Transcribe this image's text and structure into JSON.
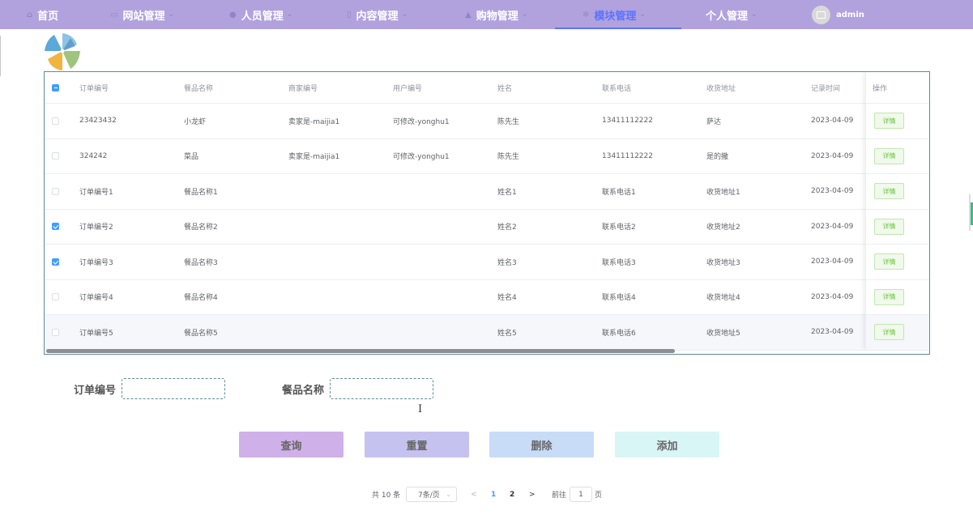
{
  "nav": {
    "items": [
      {
        "label": "首页",
        "icon": "home-icon",
        "glyph": "⌂",
        "caret": ""
      },
      {
        "label": "网站管理",
        "icon": "monitor-icon",
        "glyph": "▭",
        "caret": "⌄"
      },
      {
        "label": "人员管理",
        "icon": "user-icon",
        "glyph": "●",
        "caret": "⌄"
      },
      {
        "label": "内容管理",
        "icon": "document-icon",
        "glyph": "▯",
        "caret": "⌄"
      },
      {
        "label": "购物管理",
        "icon": "bag-icon",
        "glyph": "▲",
        "caret": "⌄"
      },
      {
        "label": "模块管理",
        "icon": "gear-icon",
        "glyph": "✲",
        "caret": "⌄"
      },
      {
        "label": "个人管理",
        "icon": "",
        "glyph": "",
        "caret": "⌄"
      }
    ],
    "active_index": 5,
    "active_color": "#5b73ff",
    "bar_color": "#b1a2de",
    "username": "admin"
  },
  "table": {
    "headers": [
      "订单编号",
      "餐品名称",
      "商家编号",
      "用户编号",
      "姓名",
      "联系电话",
      "收货地址",
      "记录时间",
      "操作"
    ],
    "rows": [
      {
        "checked": false,
        "cells": [
          "23423432",
          "小龙虾",
          "卖家是-maijia1",
          "可修改-yonghu1",
          "陈先生",
          "13411112222",
          "萨达",
          "2023-04-09"
        ],
        "action": "详情"
      },
      {
        "checked": false,
        "cells": [
          "324242",
          "菜品",
          "卖家是-maijia1",
          "可修改-yonghu1",
          "陈先生",
          "13411112222",
          "是的撒",
          "2023-04-09"
        ],
        "action": "详情"
      },
      {
        "checked": false,
        "cells": [
          "订单编号1",
          "餐品名称1",
          "",
          "",
          "姓名1",
          "联系电话1",
          "收货地址1",
          "2023-04-09"
        ],
        "action": "详情"
      },
      {
        "checked": true,
        "cells": [
          "订单编号2",
          "餐品名称2",
          "",
          "",
          "姓名2",
          "联系电话2",
          "收货地址2",
          "2023-04-09"
        ],
        "action": "详情"
      },
      {
        "checked": true,
        "cells": [
          "订单编号3",
          "餐品名称3",
          "",
          "",
          "姓名3",
          "联系电话3",
          "收货地址3",
          "2023-04-09"
        ],
        "action": "详情"
      },
      {
        "checked": false,
        "cells": [
          "订单编号4",
          "餐品名称4",
          "",
          "",
          "姓名4",
          "联系电话4",
          "收货地址4",
          "2023-04-09"
        ],
        "action": "详情"
      },
      {
        "checked": false,
        "cells": [
          "订单编号5",
          "餐品名称5",
          "",
          "",
          "姓名5",
          "联系电话6",
          "收货地址5",
          "2023-04-09"
        ],
        "action": "详情"
      }
    ],
    "header_checkbox": "indeterminate"
  },
  "search": {
    "order_no_label": "订单编号",
    "order_no_value": "",
    "dish_name_label": "餐品名称",
    "dish_name_value": ""
  },
  "actions": [
    {
      "label": "查询",
      "color": "#cfb0e8"
    },
    {
      "label": "重置",
      "color": "#c6c2ef"
    },
    {
      "label": "删除",
      "color": "#c8dcf8"
    },
    {
      "label": "添加",
      "color": "#d9f6f6"
    }
  ],
  "pagination": {
    "total_text": "共 10 条",
    "page_size": "7条/页",
    "prev": "<",
    "pages": [
      "1",
      "2"
    ],
    "current_page": "1",
    "next": ">",
    "goto_prefix": "前往",
    "goto_value": "1",
    "goto_suffix": "页"
  }
}
